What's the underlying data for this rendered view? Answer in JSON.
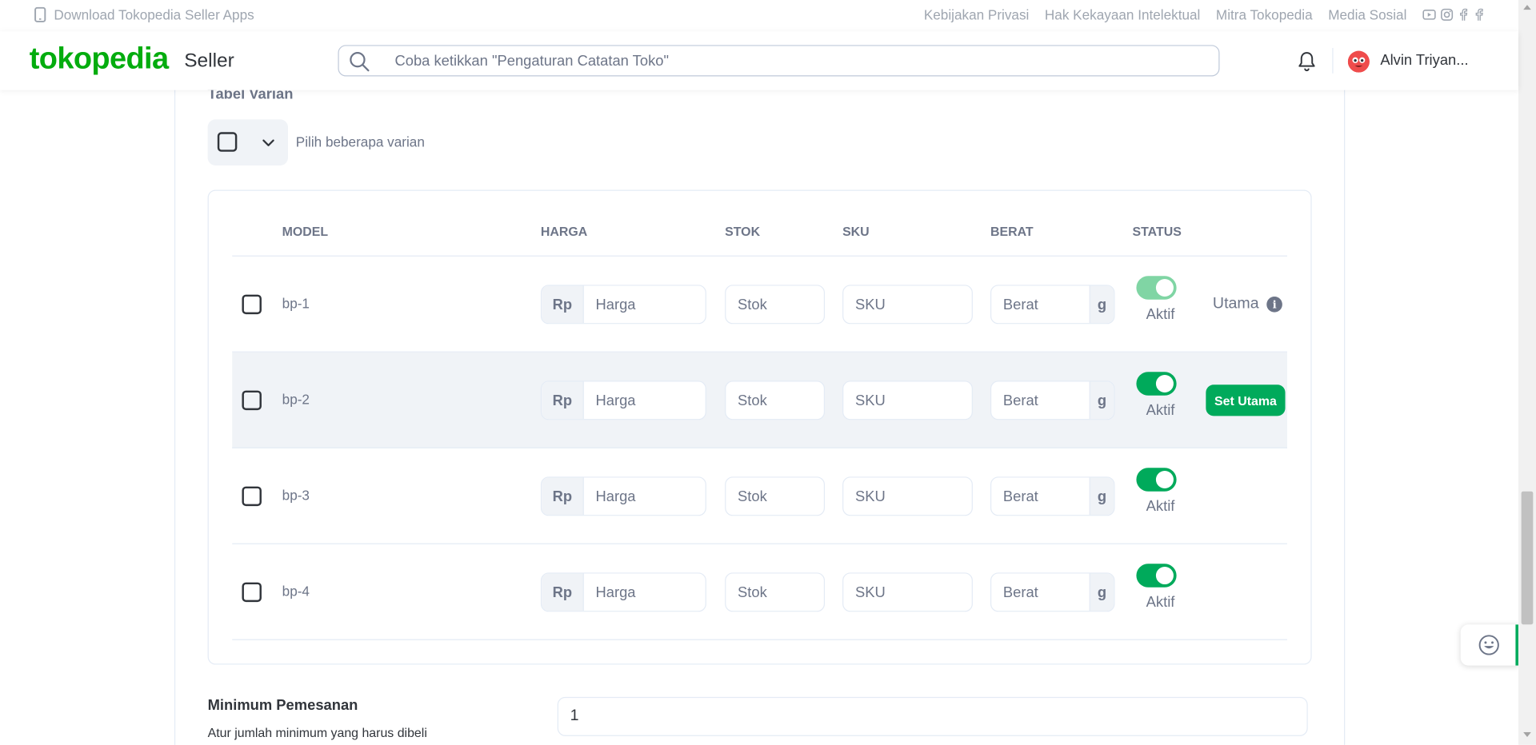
{
  "topbar": {
    "download_label": "Download Tokopedia Seller Apps",
    "links": [
      "Kebijakan Privasi",
      "Hak Kekayaan Intelektual",
      "Mitra Tokopedia",
      "Media Sosial"
    ],
    "social_icons": [
      "youtube-icon",
      "instagram-icon",
      "facebook-icon",
      "facebook-icon"
    ]
  },
  "header": {
    "logo": "tokopedia",
    "seller_label": "Seller",
    "search_placeholder": "Coba ketikkan \"Pengaturan Catatan Toko\"",
    "user_name": "Alvin Triyan..."
  },
  "variants": {
    "title": "Tabel Varian",
    "select_label": "Pilih beberapa varian",
    "columns": [
      "MODEL",
      "HARGA",
      "STOK",
      "SKU",
      "BERAT",
      "STATUS"
    ],
    "rows": [
      {
        "model": "bp-1",
        "price_prefix": "Rp",
        "price_ph": "Harga",
        "stock_ph": "Stok",
        "sku_ph": "SKU",
        "weight_ph": "Berat",
        "weight_suffix": "g",
        "status": "Aktif",
        "action": "Utama"
      },
      {
        "model": "bp-2",
        "price_prefix": "Rp",
        "price_ph": "Harga",
        "stock_ph": "Stok",
        "sku_ph": "SKU",
        "weight_ph": "Berat",
        "weight_suffix": "g",
        "status": "Aktif",
        "action": "Set Utama"
      },
      {
        "model": "bp-3",
        "price_prefix": "Rp",
        "price_ph": "Harga",
        "stock_ph": "Stok",
        "sku_ph": "SKU",
        "weight_ph": "Berat",
        "weight_suffix": "g",
        "status": "Aktif",
        "action": ""
      },
      {
        "model": "bp-4",
        "price_prefix": "Rp",
        "price_ph": "Harga",
        "stock_ph": "Stok",
        "sku_ph": "SKU",
        "weight_ph": "Berat",
        "weight_suffix": "g",
        "status": "Aktif",
        "action": ""
      }
    ]
  },
  "minimum_order": {
    "title": "Minimum Pemesanan",
    "description": "Atur jumlah minimum yang harus dibeli",
    "value": "1"
  },
  "colors": {
    "brand": "#03ac0e",
    "accent": "#00aa5b",
    "text_muted": "#6d7588"
  }
}
